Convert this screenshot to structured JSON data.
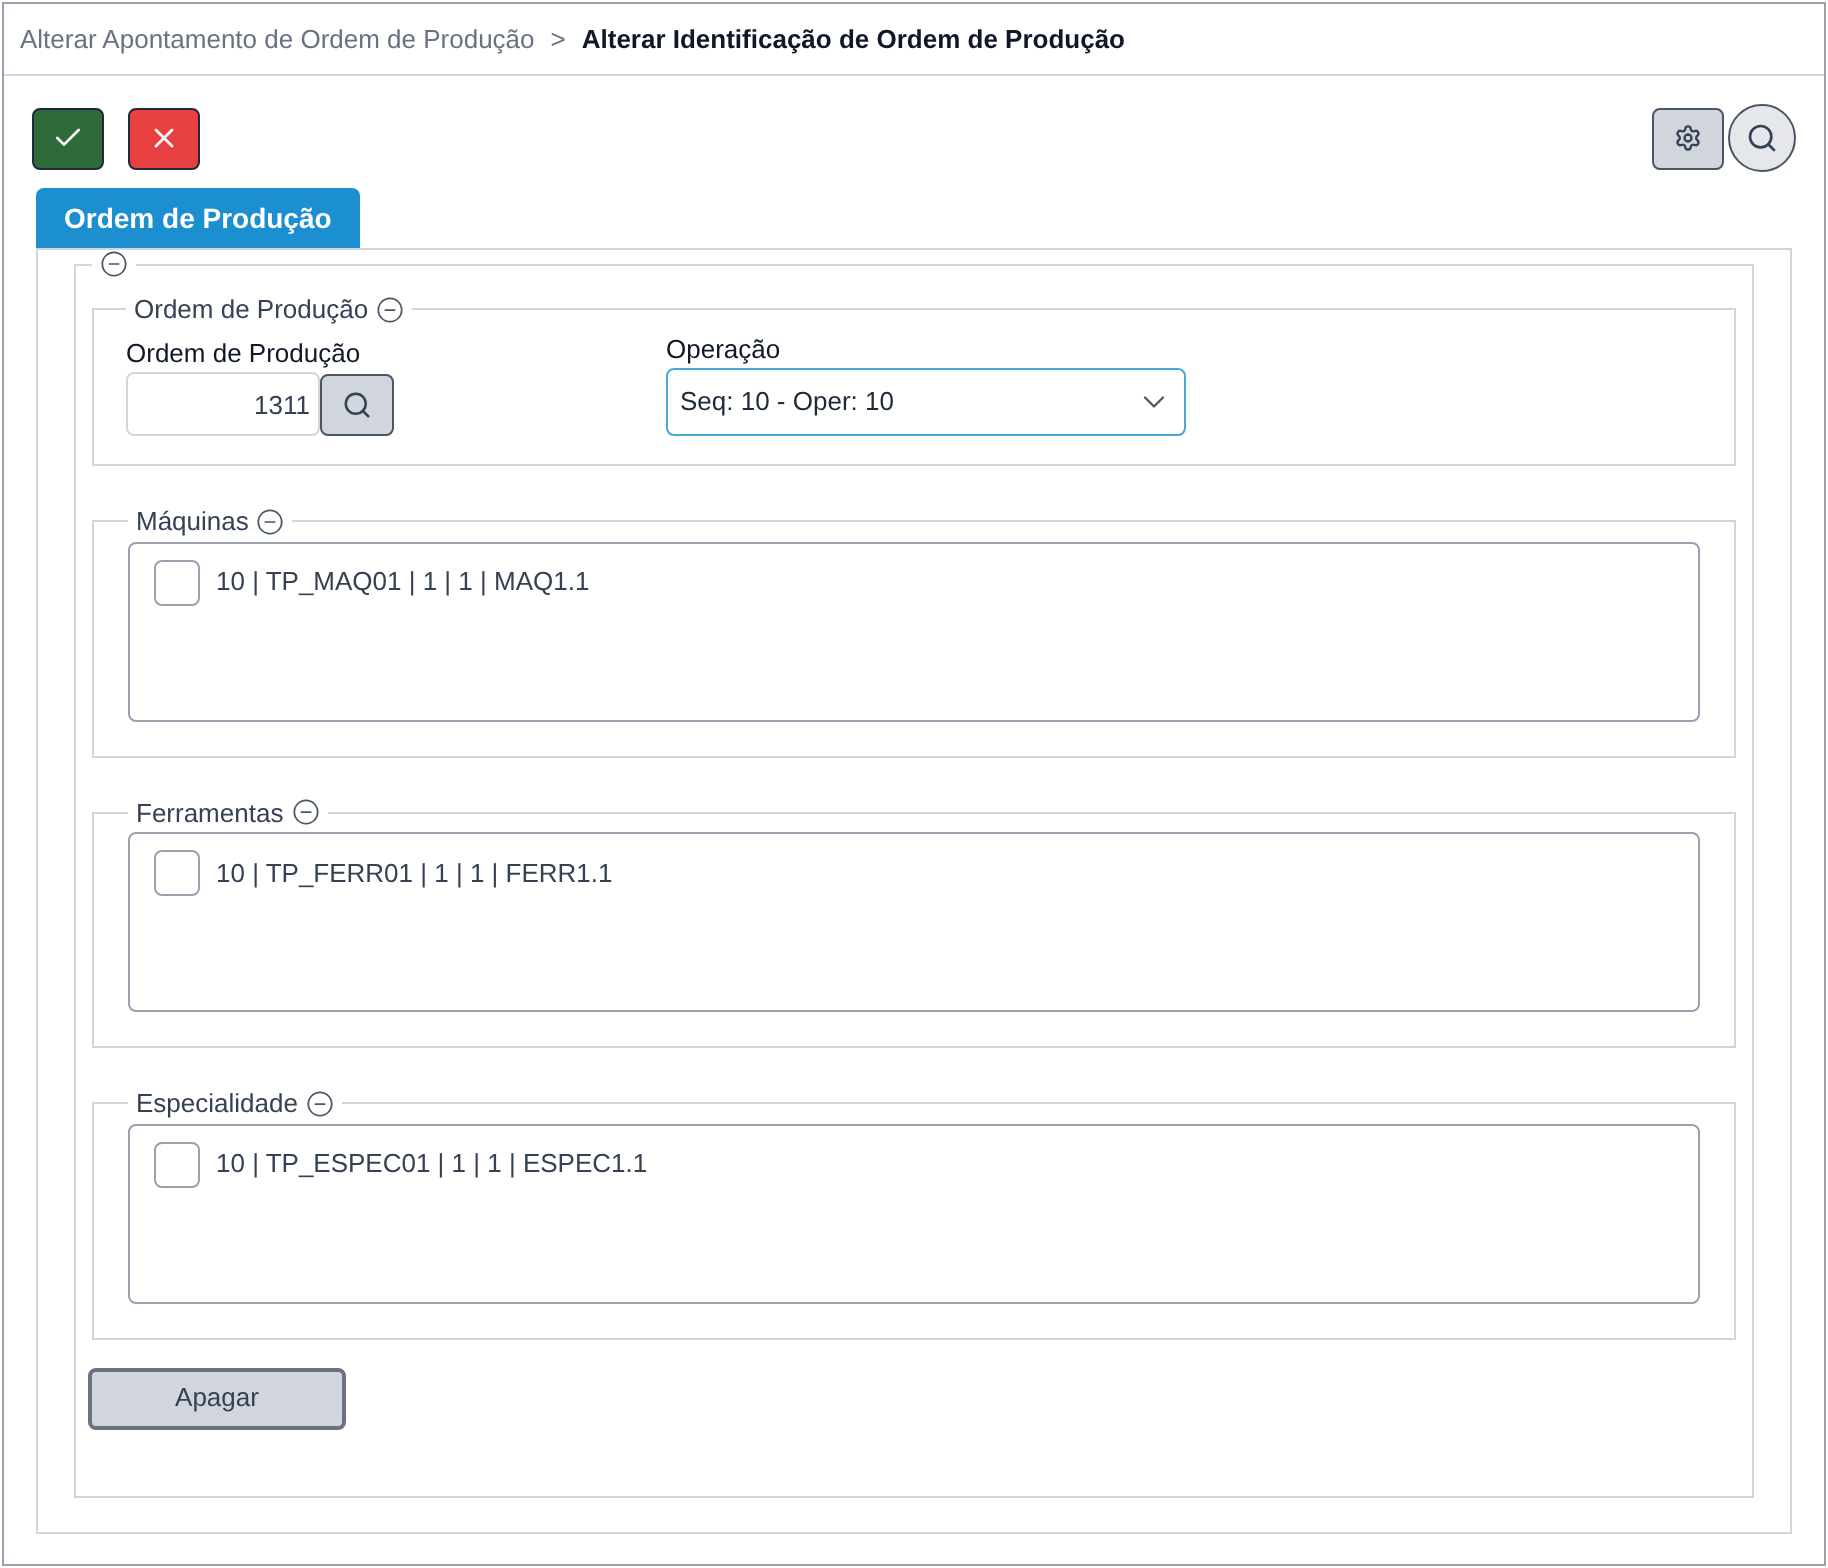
{
  "breadcrumb": {
    "parent": "Alterar Apontamento de Ordem de Produção",
    "separator": ">",
    "current": "Alterar Identificação de Ordem de Produção"
  },
  "tabs": [
    {
      "label": "Ordem de Produção",
      "selected": true
    }
  ],
  "order_section": {
    "legend": "Ordem de Produção",
    "order_field": {
      "label": "Ordem de Produção",
      "value": "1311"
    },
    "operation_field": {
      "label": "Operação",
      "value": "Seq: 10 - Oper: 10"
    }
  },
  "lists": [
    {
      "legend": "Máquinas",
      "items": [
        {
          "label": "10 | TP_MAQ01 | 1 | 1 | MAQ1.1",
          "checked": false
        }
      ]
    },
    {
      "legend": "Ferramentas",
      "items": [
        {
          "label": "10 | TP_FERR01 | 1 | 1 | FERR1.1",
          "checked": false
        }
      ]
    },
    {
      "legend": "Especialidade",
      "items": [
        {
          "label": "10 | TP_ESPEC01 | 1 | 1 | ESPEC1.1",
          "checked": false
        }
      ]
    }
  ],
  "delete_button": "Apagar"
}
